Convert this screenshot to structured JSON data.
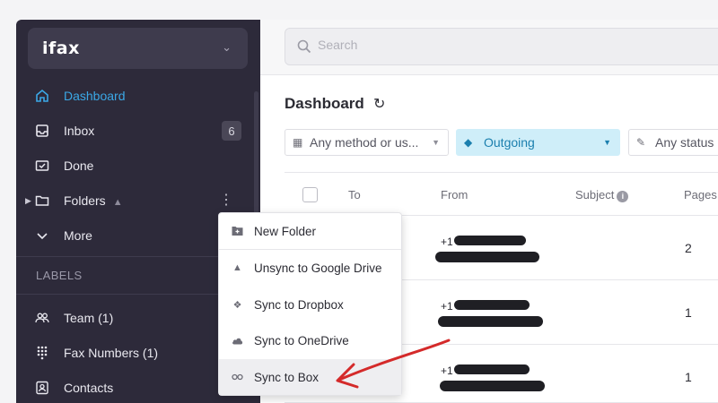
{
  "app": {
    "logo": "ifax"
  },
  "sidebar": {
    "items": [
      {
        "label": "Dashboard",
        "icon": "home-icon",
        "active": true
      },
      {
        "label": "Inbox",
        "icon": "inbox-icon",
        "count": "6"
      },
      {
        "label": "Done",
        "icon": "done-icon"
      },
      {
        "label": "Folders",
        "icon": "folder-icon",
        "badge_icon": "google-drive-icon"
      },
      {
        "label": "More",
        "icon": "chevron-down-icon"
      }
    ],
    "labels_heading": "LABELS",
    "label_items": [
      {
        "label": "Team (1)",
        "icon": "team-icon"
      },
      {
        "label": "Fax Numbers (1)",
        "icon": "dialpad-icon"
      },
      {
        "label": "Contacts",
        "icon": "contacts-icon"
      }
    ]
  },
  "search": {
    "placeholder": "Search"
  },
  "main": {
    "title": "Dashboard",
    "filters": [
      {
        "label": "Any method or us...",
        "icon": "grid-icon"
      },
      {
        "label": "Outgoing",
        "icon": "diamond-icon",
        "selected": true
      },
      {
        "label": "Any status",
        "icon": "status-icon"
      }
    ],
    "columns": [
      "To",
      "From",
      "Subject",
      "Pages"
    ],
    "rows": [
      {
        "from_prefix": "+1",
        "pages": "2"
      },
      {
        "from_prefix": "+1",
        "pages": "1"
      },
      {
        "from_prefix": "+1",
        "pages": "1"
      }
    ]
  },
  "context_menu": {
    "items": [
      {
        "label": "New Folder",
        "icon": "new-folder-icon"
      },
      {
        "label": "Unsync to Google Drive",
        "icon": "google-drive-icon"
      },
      {
        "label": "Sync to Dropbox",
        "icon": "dropbox-icon"
      },
      {
        "label": "Sync to OneDrive",
        "icon": "onedrive-icon"
      },
      {
        "label": "Sync to Box",
        "icon": "box-icon",
        "highlighted": true
      }
    ]
  },
  "colors": {
    "sidebar_bg": "#2d2a3a",
    "accent": "#3ba8e6",
    "outgoing_bg": "#cfeef9",
    "annotation_arrow": "#d42a2a"
  }
}
